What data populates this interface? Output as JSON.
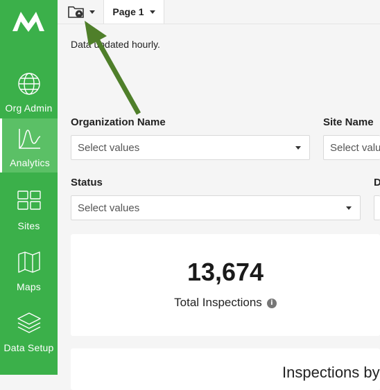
{
  "sidebar": {
    "logo": "logo-icon",
    "items": [
      {
        "label": "Org Admin",
        "icon": "globe-icon",
        "active": false
      },
      {
        "label": "Analytics",
        "icon": "analytics-chart-icon",
        "active": true
      },
      {
        "label": "Sites",
        "icon": "grid-icon",
        "active": false
      },
      {
        "label": "Maps",
        "icon": "map-icon",
        "active": false
      },
      {
        "label": "Data Setup",
        "icon": "layers-icon",
        "active": false
      }
    ]
  },
  "topbar": {
    "folder_icon": "folder-upload-icon",
    "page_tab": "Page 1"
  },
  "main": {
    "note": "Data updated hourly.",
    "filters": {
      "org_label": "Organization Name",
      "org_placeholder": "Select values",
      "site_label": "Site Name",
      "site_placeholder": "Select values",
      "status_label": "Status",
      "status_placeholder": "Select values",
      "fourth_label": "D"
    },
    "kpi": {
      "value": "13,674",
      "label": "Total Inspections"
    },
    "card2_title": "Inspections by"
  },
  "colors": {
    "sidebar": "#3bb04a",
    "sidebar_active": "#5bc066",
    "annotation_arrow": "#4f7f2a"
  }
}
